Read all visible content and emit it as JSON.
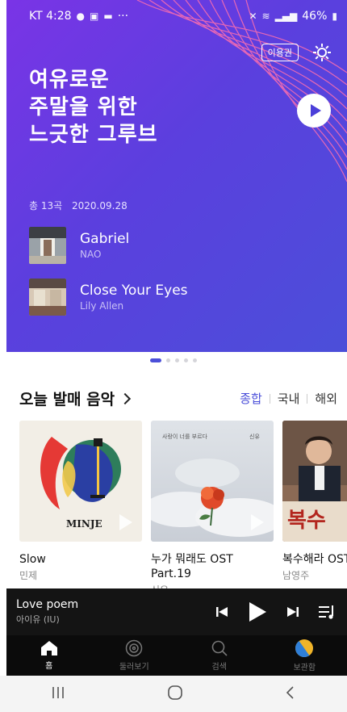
{
  "status_bar": {
    "carrier_time": "KT 4:28",
    "dots": "···",
    "battery": "46%"
  },
  "hero": {
    "ticket_label": "이용권",
    "title_lines": [
      "여유로운",
      "주말을 위한",
      "느긋한 그루브"
    ],
    "track_count": "총 13곡",
    "date": "2020.09.28",
    "tracks": [
      {
        "name": "Gabriel",
        "artist": "NAO"
      },
      {
        "name": "Close Your Eyes",
        "artist": "Lily Allen"
      }
    ],
    "carousel": {
      "total": 5,
      "active_index": 0
    }
  },
  "today_release": {
    "title": "오늘 발매 음악",
    "filters": [
      "종합",
      "국내",
      "해외"
    ],
    "active_filter": "종합",
    "albums": [
      {
        "title": "Slow",
        "artist": "민제",
        "cover_text": "MINJE"
      },
      {
        "title": "누가 뭐래도 OST Part.19",
        "title_line1": "누가 뭐래도 OST",
        "title_line2": "Part.19",
        "artist": "신유",
        "cover_text_top": "사랑이 너를 부르다",
        "cover_text_right": "신유"
      },
      {
        "title": "복수해라 OST",
        "artist": "남영주",
        "cover_text": "복수"
      }
    ]
  },
  "mini_player": {
    "title": "Love poem",
    "artist": "아이유 (IU)"
  },
  "bottom_nav": {
    "items": [
      {
        "label": "홈",
        "icon": "home-icon"
      },
      {
        "label": "둘러보기",
        "icon": "disc-icon"
      },
      {
        "label": "검색",
        "icon": "search-icon"
      },
      {
        "label": "보관함",
        "icon": "library-icon"
      }
    ],
    "active_index": 0
  },
  "colors": {
    "accent": "#4b4fd9",
    "hero_start": "#7a34e6",
    "hero_end": "#4b4fd9",
    "player_bg": "#141414"
  }
}
